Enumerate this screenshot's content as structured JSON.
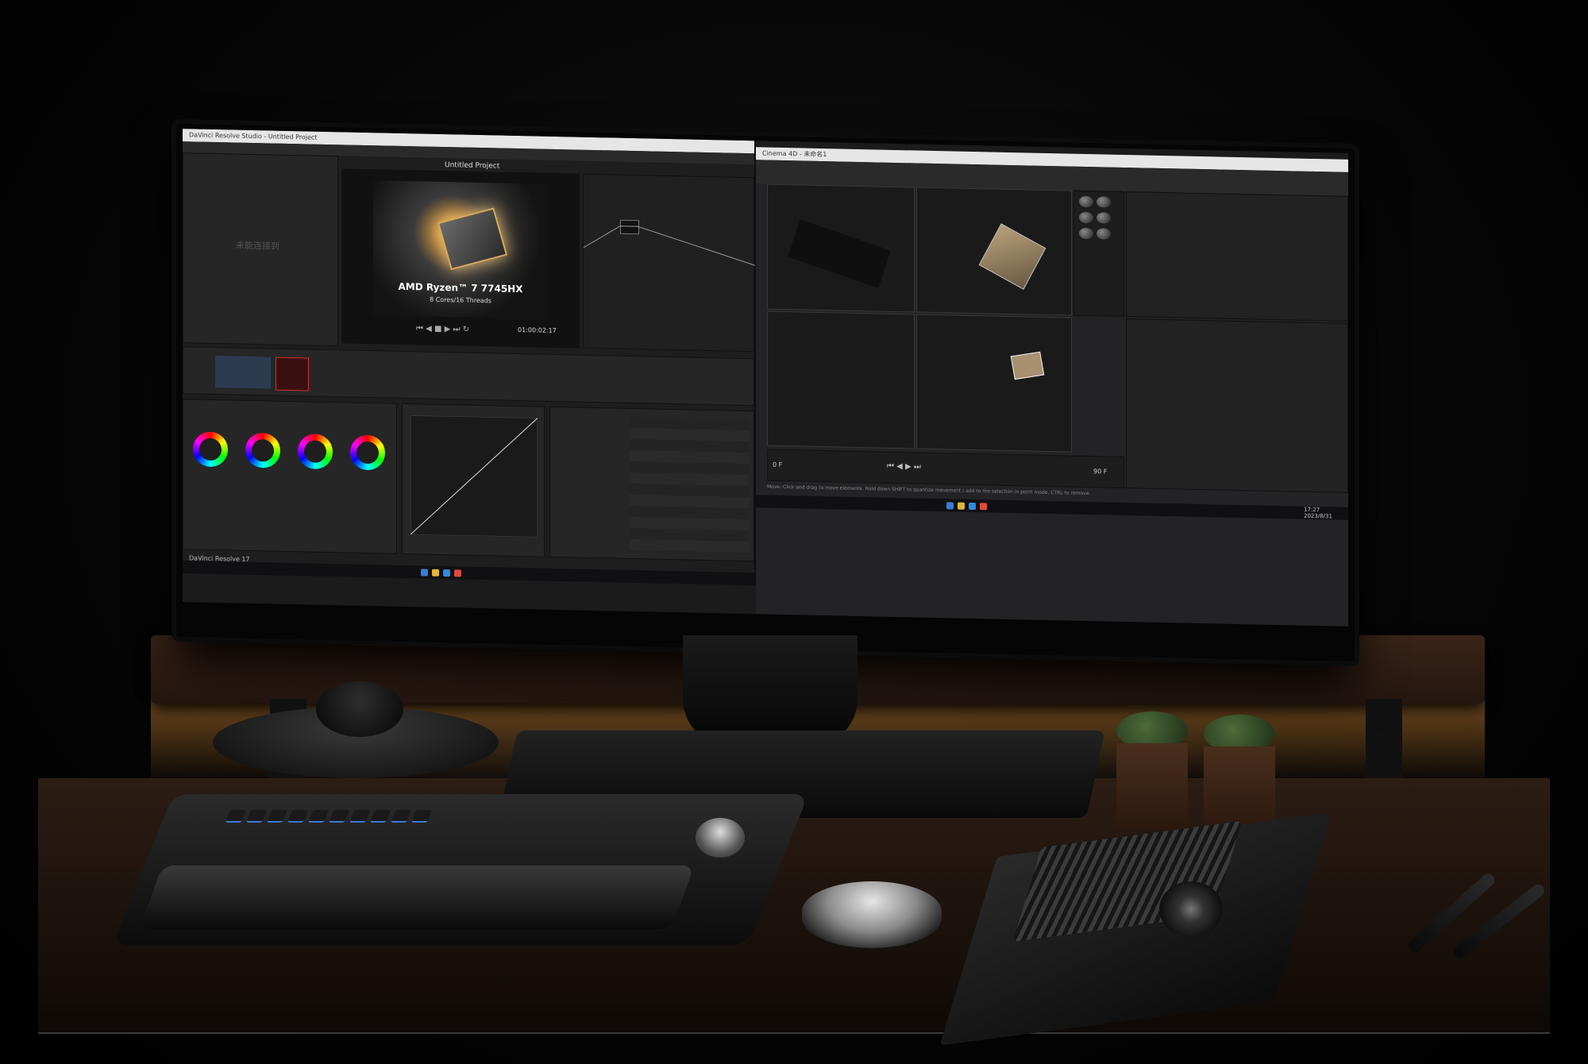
{
  "left_app": {
    "window_title": "DaVinci Resolve Studio - Untitled Project",
    "project_title": "Untitled Project",
    "empty_media_text": "未能连接到",
    "timecode": "01:00:02:17",
    "viewer_caption_title": "AMD Ryzen™ 7 7745HX",
    "viewer_caption_sub": "8 Cores/16 Threads",
    "bottom_label": "DaVinci Resolve 17"
  },
  "right_app": {
    "window_title": "Cinema 4D - 未命名1",
    "status_text": "Move: Click and drag to move elements. Hold down SHIFT to quantize movement / add to the selection in point mode, CTRL to remove.",
    "frame_field": "0 F",
    "end_frame": "90 F"
  },
  "taskbar": {
    "clock_time": "17:27",
    "clock_date": "2023/8/31"
  },
  "colors": {
    "shelf_glow": "#d29a45",
    "chip_glow": "#f3c77a",
    "key_backlight": "#3a7bd5"
  }
}
